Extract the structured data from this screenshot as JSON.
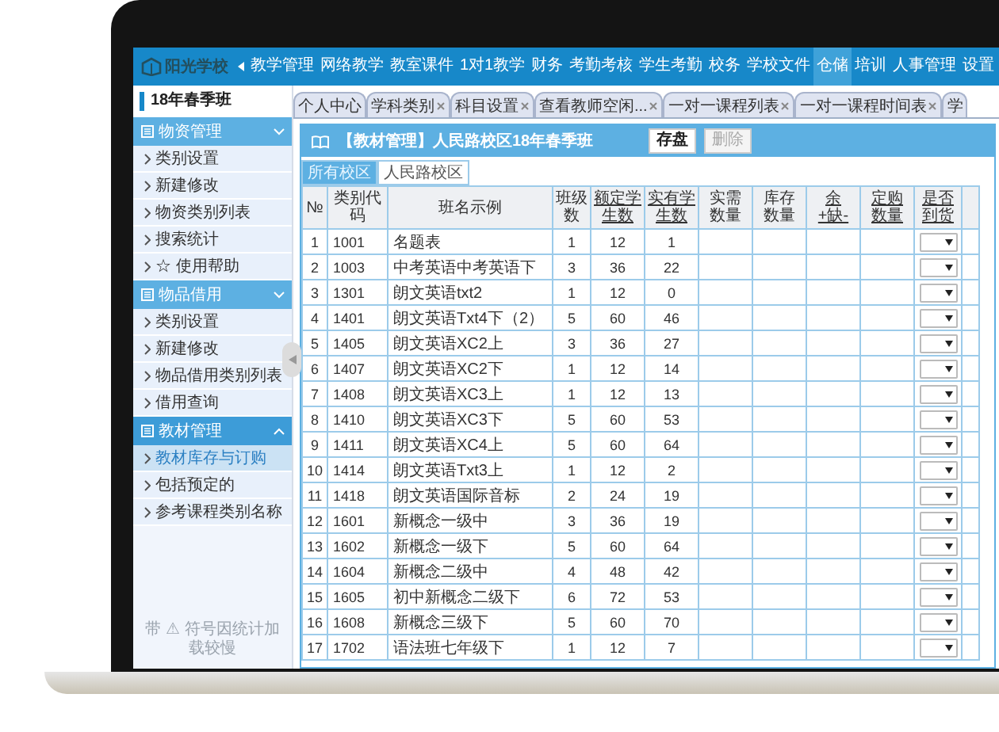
{
  "nav": {
    "logo": "阳光学校",
    "items": [
      {
        "label": "教学管理",
        "selected": false
      },
      {
        "label": "网络教学",
        "selected": false
      },
      {
        "label": "教室课件",
        "selected": false
      },
      {
        "label": "1对1教学",
        "selected": false
      },
      {
        "label": "财务",
        "selected": false
      },
      {
        "label": "考勤考核",
        "selected": false
      },
      {
        "label": "学生考勤",
        "selected": false
      },
      {
        "label": "校务",
        "selected": false
      },
      {
        "label": "学校文件",
        "selected": false
      },
      {
        "label": "仓储",
        "selected": true
      },
      {
        "label": "培训",
        "selected": false
      },
      {
        "label": "人事管理",
        "selected": false
      },
      {
        "label": "设置",
        "selected": false
      }
    ]
  },
  "sidebar": {
    "term": "18年春季班",
    "groups": [
      {
        "title": "物资管理",
        "selected": false,
        "items": [
          {
            "label": "类别设置",
            "selected": false
          },
          {
            "label": "新建修改",
            "selected": false
          },
          {
            "label": "物资类别列表",
            "selected": false
          },
          {
            "label": "搜索统计",
            "selected": false
          },
          {
            "label": "☆ 使用帮助",
            "selected": false
          }
        ]
      },
      {
        "title": "物品借用",
        "selected": false,
        "items": [
          {
            "label": "类别设置",
            "selected": false
          },
          {
            "label": "新建修改",
            "selected": false
          },
          {
            "label": "物品借用类别列表",
            "selected": false
          },
          {
            "label": "借用查询",
            "selected": false
          }
        ]
      },
      {
        "title": "教材管理",
        "selected": true,
        "items": [
          {
            "label": "教材库存与订购",
            "selected": true
          },
          {
            "label": "包括预定的",
            "selected": false
          },
          {
            "label": "参考课程类别名称",
            "selected": false
          }
        ]
      }
    ],
    "note": "带 ⚠ 符号因统计加载较慢"
  },
  "tabs": [
    {
      "label": "个人中心",
      "closable": false
    },
    {
      "label": "学科类别",
      "closable": true
    },
    {
      "label": "科目设置",
      "closable": true
    },
    {
      "label": "查看教师空闲...",
      "closable": true
    },
    {
      "label": "一对一课程列表",
      "closable": true
    },
    {
      "label": "一对一课程时间表",
      "closable": true
    },
    {
      "label": "学",
      "closable": false
    }
  ],
  "panel": {
    "title": "【教材管理】人民路校区18年春季班",
    "buttons": [
      {
        "label": "存盘",
        "disabled": false
      },
      {
        "label": "删除",
        "disabled": true
      }
    ],
    "campus_tabs": [
      {
        "label": "所有校区",
        "selected": true
      },
      {
        "label": "人民路校区",
        "selected": false
      }
    ],
    "table": {
      "columns": [
        {
          "label": "№",
          "sortable": false
        },
        {
          "label": "类别代码",
          "sortable": false
        },
        {
          "label": "班名示例",
          "sortable": false
        },
        {
          "label": "班级数",
          "sortable": false
        },
        {
          "label": "额定学生数",
          "sortable": true
        },
        {
          "label": "实有学生数",
          "sortable": true
        },
        {
          "label": "实需数量",
          "sortable": false
        },
        {
          "label": "库存数量",
          "sortable": false
        },
        {
          "label": "余+缺-",
          "sortable": true
        },
        {
          "label": "定购数量",
          "sortable": true
        },
        {
          "label": "是否到货",
          "sortable": true
        }
      ],
      "rows": [
        {
          "no": "1",
          "code": "1001",
          "name": "名题表",
          "classes": "1",
          "quota": "12",
          "enrolled": "1"
        },
        {
          "no": "2",
          "code": "1003",
          "name": "中考英语中考英语下",
          "classes": "3",
          "quota": "36",
          "enrolled": "22"
        },
        {
          "no": "3",
          "code": "1301",
          "name": "朗文英语txt2",
          "classes": "1",
          "quota": "12",
          "enrolled": "0"
        },
        {
          "no": "4",
          "code": "1401",
          "name": "朗文英语Txt4下（2）",
          "classes": "5",
          "quota": "60",
          "enrolled": "46"
        },
        {
          "no": "5",
          "code": "1405",
          "name": "朗文英语XC2上",
          "classes": "3",
          "quota": "36",
          "enrolled": "27"
        },
        {
          "no": "6",
          "code": "1407",
          "name": "朗文英语XC2下",
          "classes": "1",
          "quota": "12",
          "enrolled": "14"
        },
        {
          "no": "7",
          "code": "1408",
          "name": "朗文英语XC3上",
          "classes": "1",
          "quota": "12",
          "enrolled": "13"
        },
        {
          "no": "8",
          "code": "1410",
          "name": "朗文英语XC3下",
          "classes": "5",
          "quota": "60",
          "enrolled": "53"
        },
        {
          "no": "9",
          "code": "1411",
          "name": "朗文英语XC4上",
          "classes": "5",
          "quota": "60",
          "enrolled": "64"
        },
        {
          "no": "10",
          "code": "1414",
          "name": "朗文英语Txt3上",
          "classes": "1",
          "quota": "12",
          "enrolled": "2"
        },
        {
          "no": "11",
          "code": "1418",
          "name": "朗文英语国际音标",
          "classes": "2",
          "quota": "24",
          "enrolled": "19"
        },
        {
          "no": "12",
          "code": "1601",
          "name": "新概念一级中",
          "classes": "3",
          "quota": "36",
          "enrolled": "19"
        },
        {
          "no": "13",
          "code": "1602",
          "name": "新概念一级下",
          "classes": "5",
          "quota": "60",
          "enrolled": "64"
        },
        {
          "no": "14",
          "code": "1604",
          "name": "新概念二级中",
          "classes": "4",
          "quota": "48",
          "enrolled": "42"
        },
        {
          "no": "15",
          "code": "1605",
          "name": "初中新概念二级下",
          "classes": "6",
          "quota": "72",
          "enrolled": "53"
        },
        {
          "no": "16",
          "code": "1608",
          "name": "新概念三级下",
          "classes": "5",
          "quota": "60",
          "enrolled": "70"
        },
        {
          "no": "17",
          "code": "1702",
          "name": "语法班七年级下",
          "classes": "1",
          "quota": "12",
          "enrolled": "7"
        }
      ]
    }
  }
}
